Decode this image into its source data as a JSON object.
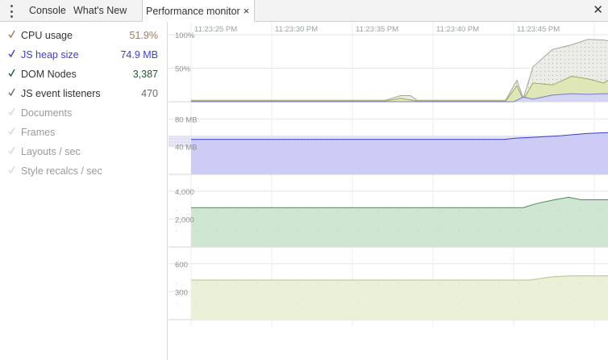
{
  "tabbar": {
    "tabs": [
      {
        "label": "Console"
      },
      {
        "label": "What's New"
      },
      {
        "label": "Performance monitor",
        "active": true
      }
    ],
    "tab_close_glyph": "×",
    "panel_close_glyph": "✕"
  },
  "metrics": [
    {
      "label": "CPU usage",
      "value": "51.9%",
      "enabled": true,
      "color": "#9c7b5a"
    },
    {
      "label": "JS heap size",
      "value": "74.9 MB",
      "enabled": true,
      "color": "#3d3fcc"
    },
    {
      "label": "DOM Nodes",
      "value": "3,387",
      "enabled": true,
      "color": "#1e5a2d"
    },
    {
      "label": "JS event listeners",
      "value": "470",
      "enabled": true,
      "color": "#6b6b6b"
    },
    {
      "label": "Documents",
      "value": "",
      "enabled": false,
      "color": "#9a9a9a"
    },
    {
      "label": "Frames",
      "value": "",
      "enabled": false,
      "color": "#9a9a9a"
    },
    {
      "label": "Layouts / sec",
      "value": "",
      "enabled": false,
      "color": "#9a9a9a"
    },
    {
      "label": "Style recalcs / sec",
      "value": "",
      "enabled": false,
      "color": "#9a9a9a"
    }
  ],
  "timeline": {
    "time_labels": [
      "11:23:25 PM",
      "11:23:30 PM",
      "11:23:35 PM",
      "11:23:40 PM",
      "11:23:45 PM"
    ]
  },
  "chart_data": [
    {
      "type": "area",
      "title": "",
      "ticks": [
        "100%",
        "50%"
      ],
      "ylim": [
        0,
        100
      ],
      "x": [
        "11:23:25 PM",
        "11:23:30 PM",
        "11:23:35 PM",
        "11:23:40 PM",
        "11:23:45 PM"
      ],
      "series": [
        {
          "name": "CPU usage",
          "color": "#d6d6d0",
          "points": [
            [
              0,
              2
            ],
            [
              3,
              2
            ],
            [
              6,
              2
            ],
            [
              10,
              2
            ],
            [
              12,
              2
            ],
            [
              13,
              9
            ],
            [
              13.6,
              9
            ],
            [
              14,
              2
            ],
            [
              19.5,
              2
            ],
            [
              20.2,
              32
            ],
            [
              20.6,
              5
            ],
            [
              21.2,
              52
            ],
            [
              22.4,
              78
            ],
            [
              23.6,
              85
            ],
            [
              24.6,
              93
            ],
            [
              25.6,
              92
            ],
            [
              26.6,
              88
            ],
            [
              27.5,
              82
            ]
          ]
        },
        {
          "name": "",
          "color": "#dfe6b7",
          "points": [
            [
              0,
              1
            ],
            [
              12,
              1
            ],
            [
              13,
              5
            ],
            [
              14,
              1
            ],
            [
              19.5,
              1
            ],
            [
              20.2,
              24
            ],
            [
              20.6,
              3
            ],
            [
              21.2,
              28
            ],
            [
              22.4,
              25
            ],
            [
              23.6,
              38
            ],
            [
              24.6,
              34
            ],
            [
              25.6,
              28
            ],
            [
              26.6,
              45
            ],
            [
              27.5,
              35
            ]
          ]
        },
        {
          "name": "",
          "color": "#cfcff4",
          "points": [
            [
              0,
              0
            ],
            [
              20,
              0
            ],
            [
              20.6,
              7
            ],
            [
              21.2,
              4
            ],
            [
              22.4,
              10
            ],
            [
              23.6,
              12
            ],
            [
              24.6,
              11
            ],
            [
              25.6,
              12
            ],
            [
              27.5,
              11
            ]
          ]
        }
      ]
    },
    {
      "type": "area",
      "title": "JS heap size",
      "ticks": [
        "80 MB",
        "40 MB"
      ],
      "ylim": [
        0,
        105
      ],
      "series": [
        {
          "name": "JS heap size",
          "color": "#3d3fcc",
          "points": [
            [
              0,
              50.5
            ],
            [
              19.4,
              50.5
            ],
            [
              20,
              52
            ],
            [
              21.5,
              54
            ],
            [
              23,
              56
            ],
            [
              24.5,
              59
            ],
            [
              26,
              60.5
            ],
            [
              27.5,
              61
            ]
          ]
        }
      ]
    },
    {
      "type": "area",
      "title": "DOM Nodes",
      "ticks": [
        "4,000",
        "2,000"
      ],
      "ylim": [
        0,
        5200
      ],
      "series": [
        {
          "name": "DOM Nodes",
          "color": "#2f7a3c",
          "points": [
            [
              0,
              2820
            ],
            [
              20.6,
              2820
            ],
            [
              21.4,
              3100
            ],
            [
              22.4,
              3350
            ],
            [
              23.4,
              3560
            ],
            [
              24.2,
              3380
            ],
            [
              27.5,
              3387
            ]
          ]
        }
      ]
    },
    {
      "type": "area",
      "title": "JS event listeners",
      "ticks": [
        "600",
        "300"
      ],
      "ylim": [
        0,
        780
      ],
      "series": [
        {
          "name": "JS event listeners",
          "color": "#7a8c3e",
          "points": [
            [
              0,
              425
            ],
            [
              21,
              425
            ],
            [
              22.4,
              460
            ],
            [
              23.6,
              470
            ],
            [
              27.5,
              470
            ]
          ]
        }
      ]
    }
  ]
}
